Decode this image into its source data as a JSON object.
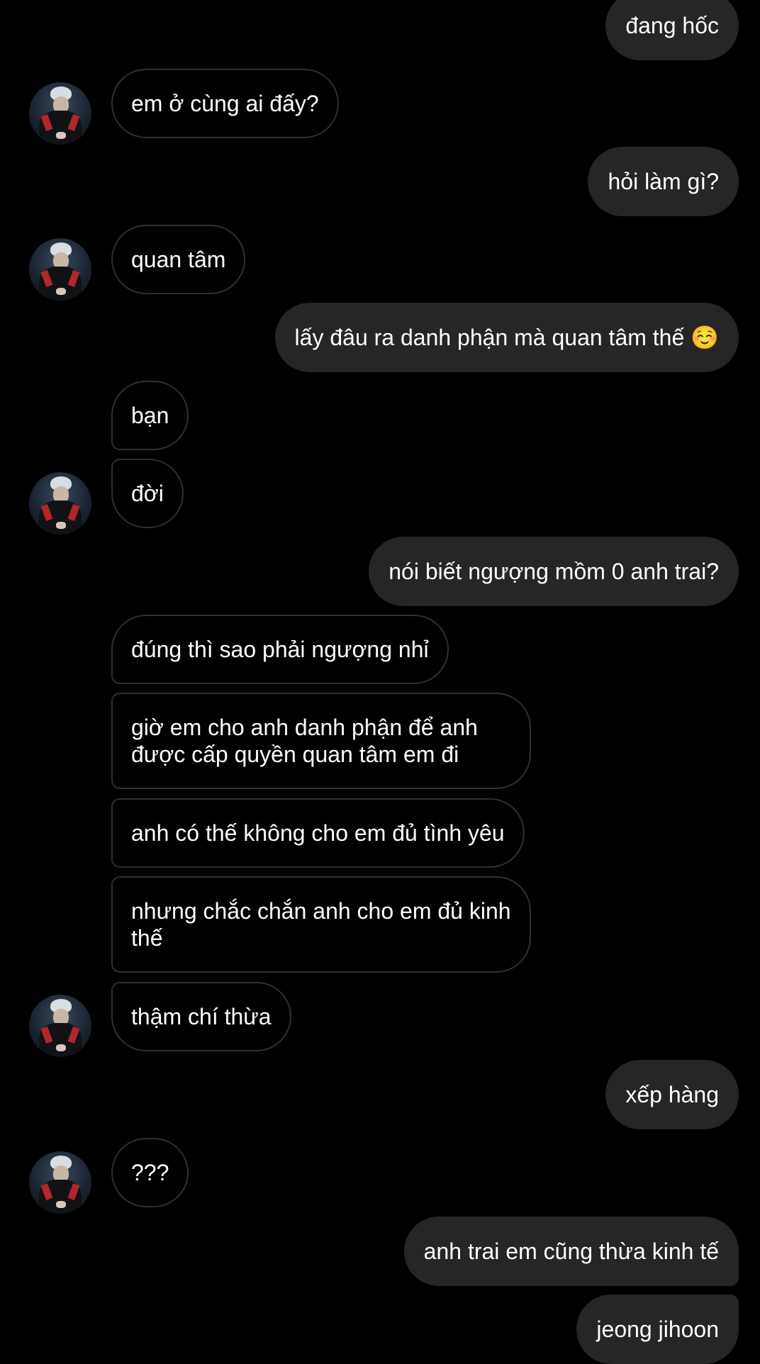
{
  "conversation": {
    "theme": {
      "background": "#000000",
      "outgoing_bubble": "#262626",
      "incoming_border": "#2f2f2f",
      "text": "#ffffff"
    },
    "contact_avatar_icon": "contact-avatar-photo",
    "messages": [
      {
        "direction": "out",
        "text": "đang hốc"
      },
      {
        "direction": "in",
        "text": "em ở cùng ai đấy?"
      },
      {
        "direction": "out",
        "text": "hỏi làm gì?"
      },
      {
        "direction": "in",
        "text": "quan tâm"
      },
      {
        "direction": "out",
        "text": "lấy đâu ra danh phận mà quan tâm thế ☺️"
      },
      {
        "direction": "in",
        "text": "bạn"
      },
      {
        "direction": "in",
        "text": "đời"
      },
      {
        "direction": "out",
        "text": "nói biết ngượng mồm 0 anh trai?"
      },
      {
        "direction": "in",
        "text": "đúng thì sao phải ngượng nhỉ"
      },
      {
        "direction": "in",
        "text": "giờ em cho anh danh phận để anh được cấp quyền quan tâm em đi"
      },
      {
        "direction": "in",
        "text": "anh có thế không cho em đủ tình yêu"
      },
      {
        "direction": "in",
        "text": "nhưng chắc chắn anh cho em đủ kinh thế"
      },
      {
        "direction": "in",
        "text": "thậm chí thừa"
      },
      {
        "direction": "out",
        "text": "xếp hàng"
      },
      {
        "direction": "in",
        "text": "???"
      },
      {
        "direction": "out",
        "text": "anh trai em cũng thừa kinh tế"
      },
      {
        "direction": "out",
        "text": "jeong jihoon"
      }
    ]
  }
}
